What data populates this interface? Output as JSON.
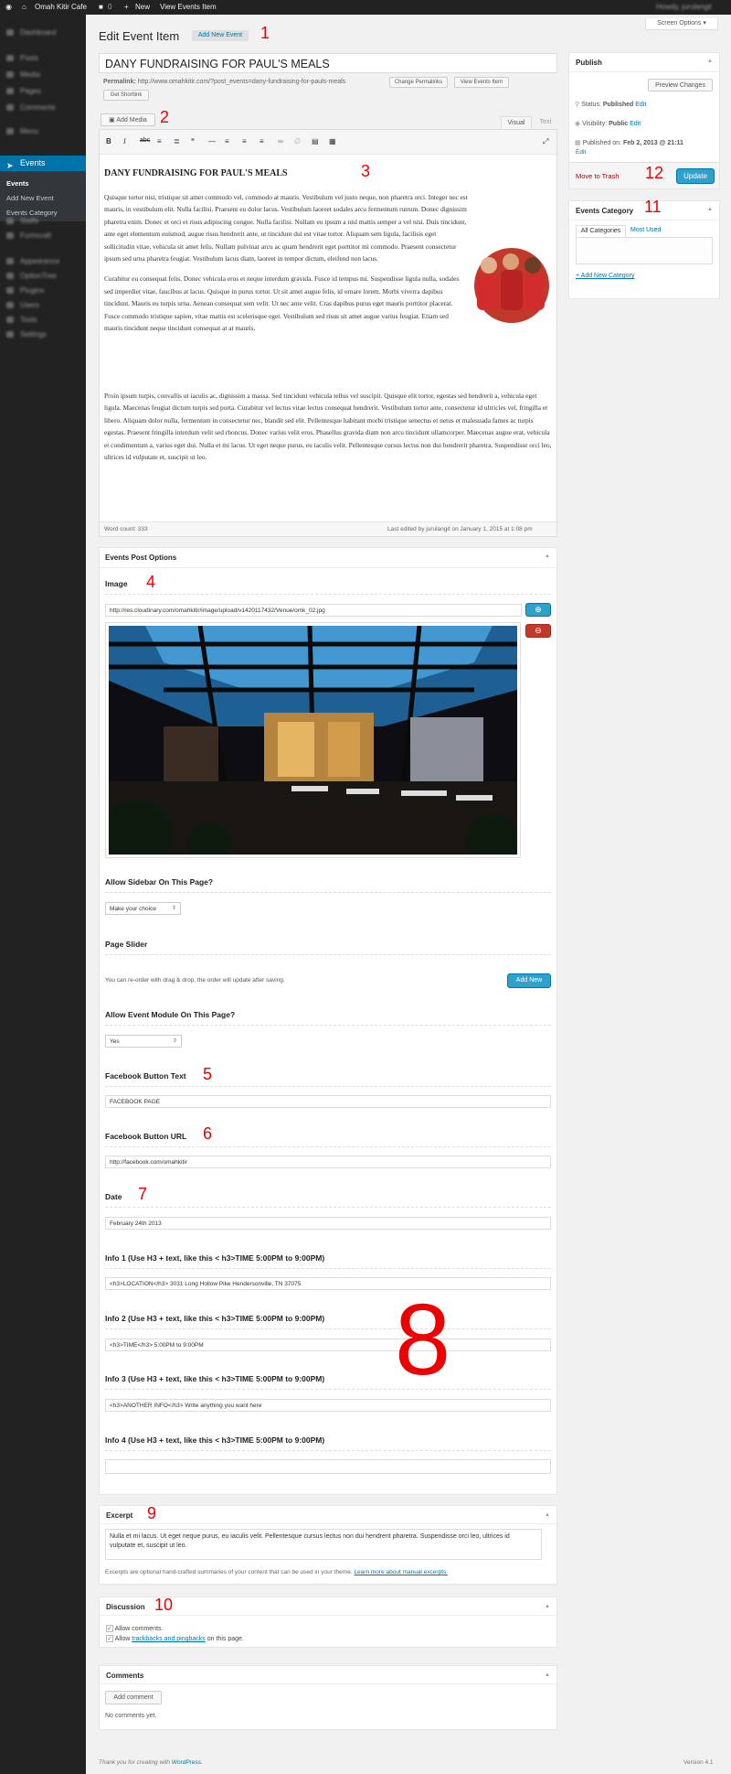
{
  "admin_bar": {
    "site_name": "Omah Kitir Cafe",
    "comments_count": "0",
    "new_label": "New",
    "view_label": "View Events Item",
    "howdy": "Howdy, jurulangit"
  },
  "sidebar": {
    "items_top": [
      "Dashboard",
      "Posts",
      "Media",
      "Pages",
      "Comments",
      "Menu"
    ],
    "active": "Events",
    "submenu": [
      "Events",
      "Add New Event",
      "Events Category"
    ],
    "items_bottom": [
      "Staffs",
      "Formcraft",
      "Appearance",
      "OptionTree",
      "Plugins",
      "Users",
      "Tools",
      "Settings"
    ]
  },
  "screen_options": "Screen Options",
  "page": {
    "title": "Edit Event Item",
    "add_new": "Add New Event"
  },
  "post": {
    "title": "DANY FUNDRAISING FOR PAUL'S MEALS",
    "permalink_label": "Permalink:",
    "permalink": "http://www.omahkitir.com/?post_events=dany-fundraising-for-pauls-meals",
    "change_permalinks": "Change Permalinks",
    "view_events_item": "View Events Item",
    "get_shortlink": "Get Shortlink"
  },
  "editor": {
    "add_media": "Add Media",
    "tab_visual": "Visual",
    "tab_text": "Text",
    "toolbar_icons": [
      "bold-icon",
      "italic-icon",
      "strikethrough-icon",
      "bullet-list-icon",
      "numbered-list-icon",
      "blockquote-icon",
      "horizontal-rule-icon",
      "align-left-icon",
      "align-center-icon",
      "align-right-icon",
      "link-icon",
      "unlink-icon",
      "read-more-icon",
      "toolbar-toggle-icon",
      "fullscreen-icon"
    ],
    "heading": "DANY FUNDRAISING FOR PAUL'S MEALS",
    "p1": "Quisque tortor nisi, tristique sit amet commodo vel, commodo at mauris. Vestibulum vel justo neque, non pharetra orci. Integer nec est mauris, in vestibulum elit. Nulla facilisi. Praesent eu dolor lacus. Vestibulum laoreet sodales arcu fermentum rutrum. Donec dignissim pharetra enim. Donec et orci et risus adipiscing congue. Nulla facilisi. Nullam eu ipsum a nisl mattis semper a vel nisi. Duis tincidunt, ante eget elementum euismod, augue risus hendrerit ante, ut tincidunt dui est vitae tortor. Aliquam sem ligula, facilisis eget sollicitudin vitae, vehicula sit amet felis. Nullam pulvinar arcu ac quam hendrerit eget porttitor mi commodo. Praesent consectetur ipsum sed urna pharetra feugiat. Vestibulum lacus diam, laoreet in tempor dictum, eleifend non lacus.",
    "p2": "Curabitur eu consequat felis. Donec vehicula eros et neque interdum gravida. Fusce id tempus mi. Suspendisse ligula nulla, sodales sed imperdiet vitae, faucibus at lacus. Quisque in purus tortor. Ut sit amet augue felis, id ornare lorem. Morbi viverra dapibus tincidunt. Mauris eu turpis urna. Aenean consequat sem velit. Ut nec ante velit. Cras dapibus purus eget mauris porttitor placerat. Fusce commodo tristique sapien, vitae mattis est scelerisque eget. Vestibulum sed risus sit amet augue varius feugiat. Etiam sed mauris tincidunt neque tincidunt consequat at at mauris.",
    "p3": "Proin ipsum turpis, convallis ut iaculis ac, dignissim a massa. Sed tincidunt vehicula tellus vel suscipit. Quisque elit tortor, egestas sed hendrerit a, vehicula eget ligula. Maecenas feugiat dictum turpis sed porta. Curabitur vel lectus vitae lectus consequat hendrerit. Vestibulum tortor ante, consectetur id ultricies vel, fringilla et libero. Aliquam dolor nulla, fermentum in consectetur nec, blandit sed elit. Pellentesque habitant morbi tristique senectus et netus et malesuada fames ac turpis egestas. Praesent fringilla interdum velit sed rhoncus. Donec varius velit eros. Phasellus gravida diam non arcu tincidunt ullamcorper. Maecenas augue erat, vehicula et condimentum a, varius eget dui. Nulla et mi lacus. Ut eget neque purus, eu iaculis velit. Pellentesque cursus lectus non dui hendrerit pharetra. Suspendisse orci leo, ultrices id vulputate et, suscipit ut leo.",
    "word_count": "Word count: 333",
    "last_edited": "Last edited by jurulangit on January 1, 2015 at 1:08 pm"
  },
  "publish": {
    "title": "Publish",
    "preview": "Preview Changes",
    "status_label": "Status:",
    "status": "Published",
    "visibility_label": "Visibility:",
    "visibility": "Public",
    "published_label": "Published on:",
    "published_on": "Feb 2, 2013 @ 21:11",
    "edit": "Edit",
    "trash": "Move to Trash",
    "update": "Update"
  },
  "category": {
    "title": "Events Category",
    "tab_all": "All Categories",
    "tab_most": "Most Used",
    "add_new": "+ Add New Category"
  },
  "options": {
    "title": "Events Post Options",
    "image_label": "Image",
    "image_url": "http://res.cloudinary.com/omahkitir/image/upload/v1420117432/Venue/omk_02.jpg",
    "sidebar_label": "Allow Sidebar On This Page?",
    "sidebar_value": "Make your choice",
    "slider_label": "Page Slider",
    "slider_desc": "You can re-order with drag & drop, the order will update after saving.",
    "add_new": "Add New",
    "module_label": "Allow Event Module On This Page?",
    "module_value": "Yes",
    "fb_text_label": "Facebook Button Text",
    "fb_text": "FACEBOOK PAGE",
    "fb_url_label": "Facebook Button URL",
    "fb_url": "http://facebook.com/omahkitir",
    "date_label": "Date",
    "date": "February 24th 2013",
    "info1_label": "Info 1 (Use H3 + text, like this < h3>TIME 5:00PM to 9:00PM)",
    "info1": "<h3>LOCATION</h3> 3031 Long Hollow Pike Hendersonville, TN 37075",
    "info2_label": "Info 2 (Use H3 + text, like this < h3>TIME 5:00PM to 9:00PM)",
    "info2": "<h3>TIME</h3> 5:00PM to 9:00PM",
    "info3_label": "Info 3 (Use H3 + text, like this < h3>TIME 5:00PM to 9:00PM)",
    "info3": "<h3>ANOTHER INFO</h3> Write anything you want here",
    "info4_label": "Info 4 (Use H3 + text, like this < h3>TIME 5:00PM to 9:00PM)",
    "info4": ""
  },
  "excerpt": {
    "title": "Excerpt",
    "text": "Nulla et mi lacus. Ut eget neque purus, eu iaculis velit. Pellentesque cursus lectus non dui hendrerit pharetra. Suspendisse orci leo, ultrices id vulputate et, suscipit ut leo.",
    "help": "Excerpts are optional hand-crafted summaries of your content that can be used in your theme.",
    "help_link": "Learn more about manual excerpts."
  },
  "discussion": {
    "title": "Discussion",
    "allow_comments": "Allow comments.",
    "allow_pre": "Allow",
    "trackbacks": "trackbacks and pingbacks",
    "allow_post": "on this page."
  },
  "comments": {
    "title": "Comments",
    "add_comment": "Add comment",
    "none": "No comments yet."
  },
  "footer": {
    "thanks": "Thank you for creating with",
    "wordpress": "WordPress.",
    "version": "Version 4.1"
  },
  "annotations": [
    "1",
    "2",
    "3",
    "4",
    "5",
    "6",
    "7",
    "8",
    "9",
    "10",
    "11",
    "12"
  ],
  "colors": {
    "accent": "#0073aa",
    "update": "#2ea2cc",
    "annotation": "#e00000",
    "trash": "#a00"
  }
}
